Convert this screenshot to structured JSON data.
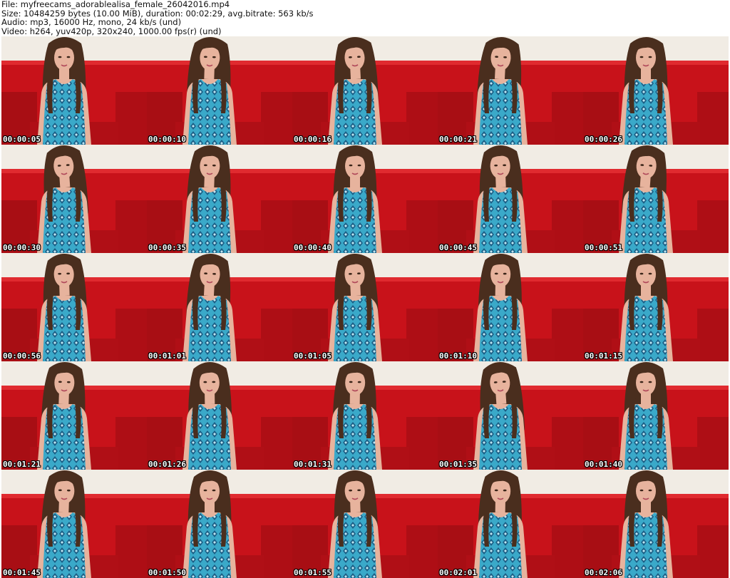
{
  "header": {
    "file": "File: myfreecams_adorablealisa_female_26042016.mp4",
    "size": "Size: 10484259 bytes (10.00 MiB), duration: 00:02:29, avg.bitrate: 563 kb/s",
    "audio": "Audio: mp3, 16000 Hz, mono, 24 kb/s (und)",
    "video": "Video: h264, yuv420p, 320x240, 1000.00 fps(r) (und)"
  },
  "colors": {
    "sofa_red": "#c8121a",
    "sofa_dark": "#8e0b10",
    "wall": "#f1ece4",
    "hair": "#4a2e1e",
    "skin": "#e7b39d",
    "dress": "#3aa9c9",
    "dress_pattern": "#1c5f86"
  },
  "thumbnails": [
    {
      "time": "00:00:05",
      "head_tilt": 0
    },
    {
      "time": "00:00:10",
      "head_tilt": 2
    },
    {
      "time": "00:00:16",
      "head_tilt": -3
    },
    {
      "time": "00:00:21",
      "head_tilt": 3
    },
    {
      "time": "00:00:26",
      "head_tilt": 0
    },
    {
      "time": "00:00:30",
      "head_tilt": -4
    },
    {
      "time": "00:00:35",
      "head_tilt": 2
    },
    {
      "time": "00:00:40",
      "head_tilt": 0
    },
    {
      "time": "00:00:45",
      "head_tilt": -2
    },
    {
      "time": "00:00:51",
      "head_tilt": 4
    },
    {
      "time": "00:00:56",
      "head_tilt": -2
    },
    {
      "time": "00:01:01",
      "head_tilt": 3
    },
    {
      "time": "00:01:05",
      "head_tilt": -3
    },
    {
      "time": "00:01:10",
      "head_tilt": 1
    },
    {
      "time": "00:01:15",
      "head_tilt": 0
    },
    {
      "time": "00:01:21",
      "head_tilt": 2
    },
    {
      "time": "00:01:26",
      "head_tilt": -1
    },
    {
      "time": "00:01:31",
      "head_tilt": 1
    },
    {
      "time": "00:01:35",
      "head_tilt": -4
    },
    {
      "time": "00:01:40",
      "head_tilt": 0
    },
    {
      "time": "00:01:45",
      "head_tilt": 2
    },
    {
      "time": "00:01:50",
      "head_tilt": 0
    },
    {
      "time": "00:01:55",
      "head_tilt": -2
    },
    {
      "time": "00:02:01",
      "head_tilt": 1
    },
    {
      "time": "00:02:06",
      "head_tilt": 0
    }
  ]
}
